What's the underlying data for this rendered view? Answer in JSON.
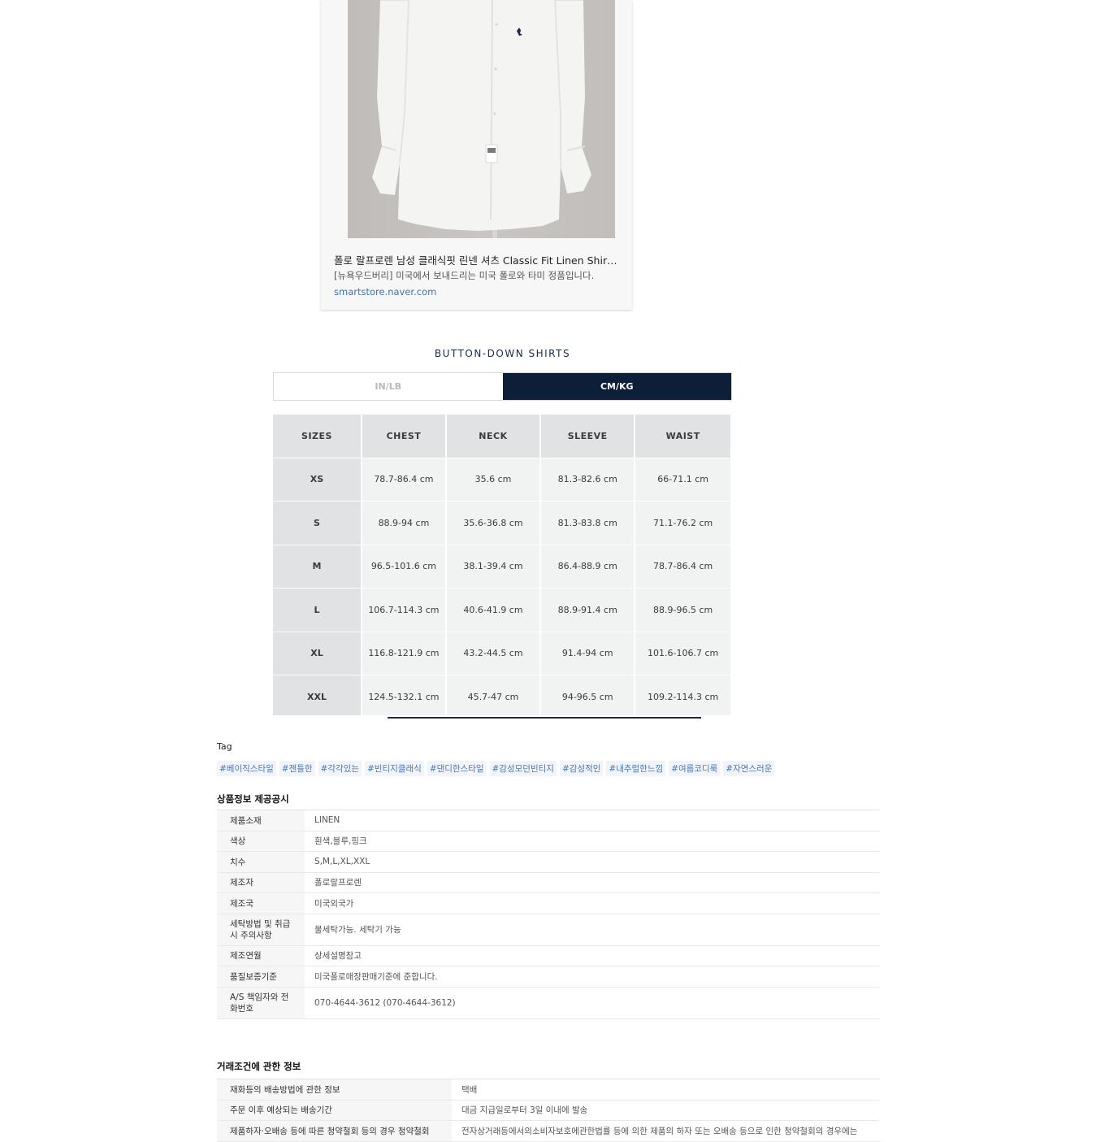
{
  "preview_card": {
    "title": "폴로 랄프로렌 남성 클래식핏 린넨 셔츠 Classic Fit Linen Shirt : 뉴욕우드버리",
    "description": "[뉴욕우드버리] 미국에서 보내드리는 미국 폴로와 타미 정품입니다.",
    "url": "smartstore.naver.com"
  },
  "size_chart": {
    "title": "BUTTON-DOWN SHIRTS",
    "unit_toggle": {
      "in_label": "IN/LB",
      "cm_label": "CM/KG",
      "selected": "CM/KG"
    },
    "headers": [
      "SIZES",
      "CHEST",
      "NECK",
      "SLEEVE",
      "WAIST"
    ],
    "rows": [
      [
        "XS",
        "78.7-86.4 cm",
        "35.6 cm",
        "81.3-82.6 cm",
        "66-71.1 cm"
      ],
      [
        "S",
        "88.9-94 cm",
        "35.6-36.8 cm",
        "81.3-83.8 cm",
        "71.1-76.2 cm"
      ],
      [
        "M",
        "96.5-101.6 cm",
        "38.1-39.4 cm",
        "86.4-88.9 cm",
        "78.7-86.4 cm"
      ],
      [
        "L",
        "106.7-114.3 cm",
        "40.6-41.9 cm",
        "88.9-91.4 cm",
        "88.9-96.5 cm"
      ],
      [
        "XL",
        "116.8-121.9 cm",
        "43.2-44.5 cm",
        "91.4-94 cm",
        "101.6-106.7 cm"
      ],
      [
        "XXL",
        "124.5-132.1 cm",
        "45.7-47 cm",
        "94-96.5 cm",
        "109.2-114.3 cm"
      ]
    ],
    "accent_color": "#0d1f38"
  },
  "tags": {
    "heading": "Tag",
    "items": [
      "#베이직스타일",
      "#젠틀한",
      "#각각있는",
      "#빈티지클래식",
      "#댄디한스타일",
      "#감성모던빈티지",
      "#감성적인",
      "#내추럴한느낌",
      "#여름코디룩",
      "#자연스러운"
    ]
  },
  "product_info": {
    "title": "상품정보 제공공시",
    "rows": [
      {
        "label": "제품소재",
        "value": "LINEN"
      },
      {
        "label": "색상",
        "value": "흰색,블루,핑크"
      },
      {
        "label": "치수",
        "value": "S,M,L,XL,XXL"
      },
      {
        "label": "제조자",
        "value": "폴로랄프로렌"
      },
      {
        "label": "제조국",
        "value": "미국외국가"
      },
      {
        "label": "세탁방법 및 취급시 주의사항",
        "value": "물세탁가능. 세탁기 가능"
      },
      {
        "label": "제조연월",
        "value": "상세설명참고"
      },
      {
        "label": "품질보증기준",
        "value": "미국폴로매장판매기준에 준합니다."
      },
      {
        "label": "A/S 책임자와 전화번호",
        "value": "070-4644-3612 (070-4644-3612)"
      }
    ]
  },
  "trade_info": {
    "title": "거래조건에 관한 정보",
    "rows": [
      {
        "label": "재화등의 배송방법에 관한 정보",
        "value": "택배"
      },
      {
        "label": "주문 이후 예상되는 배송기간",
        "value": "대금 지급일로부터 3일 이내에 발송"
      },
      {
        "label": "제품하자·오배송 등에 따른 청약철회 등의 경우 청약철회",
        "value": "전자상거래등에서의소비자보호에관한법률 등에 의한 제품의 하자 또는 오배송 등으로 인한 청약철회의 경우에는"
      }
    ]
  }
}
